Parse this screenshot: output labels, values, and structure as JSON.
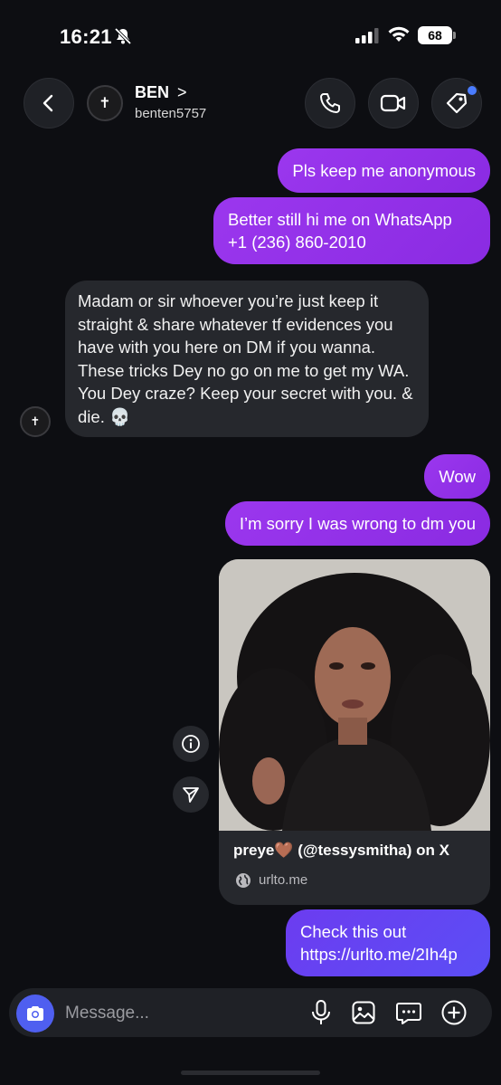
{
  "status_bar": {
    "time": "16:21",
    "battery": "68"
  },
  "header": {
    "back_label": "Back",
    "contact_name": "BEN",
    "contact_chevron": ">",
    "contact_username": "benten5757",
    "avatar_glyph": "✝"
  },
  "messages": [
    {
      "from": "me",
      "text": "Pls keep me anonymous"
    },
    {
      "from": "me",
      "text": "Better still hi me on WhatsApp +1 (236) 860-2010"
    },
    {
      "from": "them",
      "text": "Madam or sir whoever you’re just keep it straight & share whatever tf evidences you have with you here on DM if you wanna. These tricks Dey no go on me to get my WA. You Dey craze? Keep your secret with you. & die. 💀"
    },
    {
      "from": "me",
      "text": "Wow"
    },
    {
      "from": "me",
      "text": "I’m sorry I was wrong to dm you"
    },
    {
      "from": "me",
      "text": "Check this out https://urlto.me/2Ih4p"
    }
  ],
  "link_card": {
    "title": "preye🤎 (@tessysmitha) on X",
    "domain": "urlto.me"
  },
  "composer": {
    "placeholder": "Message..."
  },
  "colors": {
    "sent_purple": "#9b37ee",
    "sent_blue": "#5b4ef5",
    "received": "#26282d",
    "background": "#0d0e12",
    "camera": "#4f5ff0"
  },
  "icons": [
    "bell-slash-icon",
    "signal-icon",
    "wifi-icon",
    "battery-icon",
    "chevron-left-icon",
    "phone-icon",
    "video-icon",
    "tag-icon",
    "info-icon",
    "send-icon",
    "globe-icon",
    "camera-icon",
    "mic-icon",
    "gallery-icon",
    "sticker-icon",
    "plus-icon"
  ]
}
